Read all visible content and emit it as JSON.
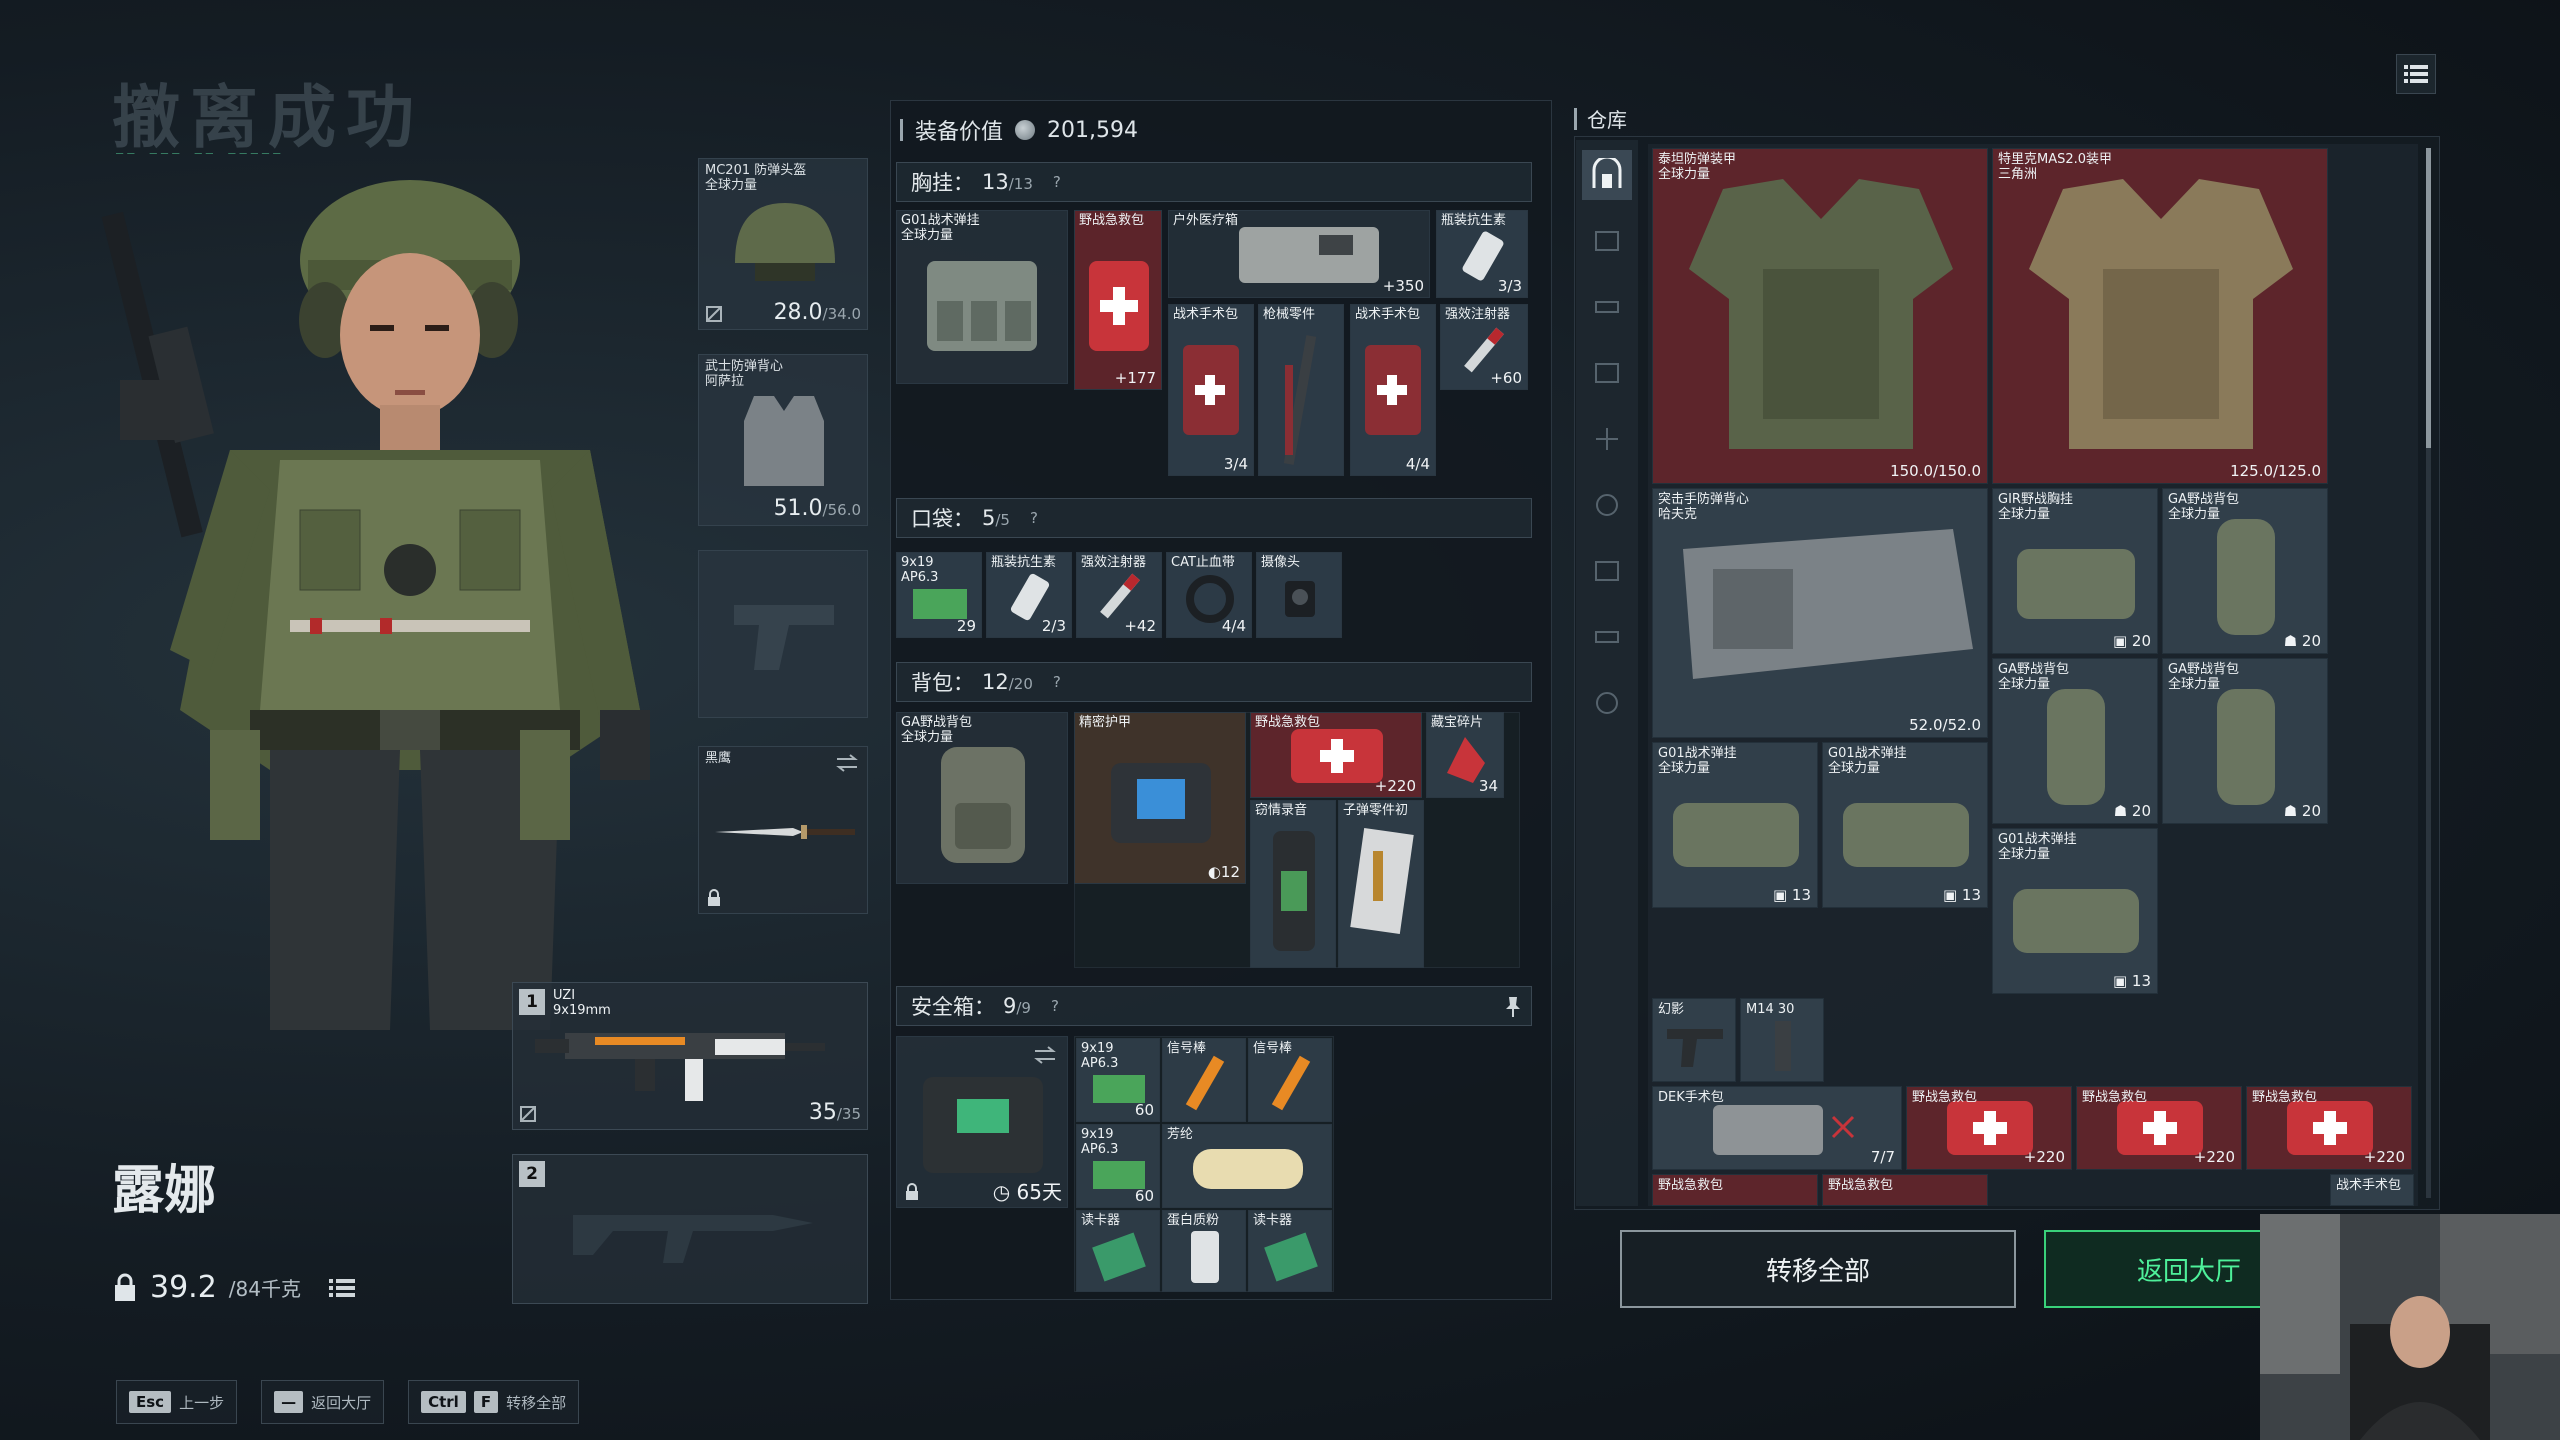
{
  "banner": {
    "title": "撤离成功"
  },
  "character": {
    "name": "露娜",
    "weight_value": "39.2",
    "weight_max": "/84千克"
  },
  "hotkeys": [
    {
      "key": "Esc",
      "label": "上一步"
    },
    {
      "key": "—",
      "label": "返回大厅"
    },
    {
      "key": "Ctrl",
      "key2": "F",
      "label": "转移全部"
    }
  ],
  "equipment": {
    "helmet": {
      "name": "MC201 防弹头盔",
      "sub": "全球力量",
      "durability": "28.0",
      "max": "/34.0"
    },
    "armor": {
      "name": "武士防弹背心",
      "sub": "阿萨拉",
      "durability": "51.0",
      "max": "/56.0"
    },
    "melee": {
      "name": "黑鹰"
    },
    "weapon1": {
      "slot": "1",
      "name": "UZI",
      "caliber": "9x19mm",
      "ammo": "35",
      "ammo_max": "/35"
    },
    "weapon2": {
      "slot": "2"
    }
  },
  "panel": {
    "value_label": "装备价值",
    "value": "201,594",
    "rig": {
      "label": "胸挂：",
      "used": "13",
      "cap": "/13"
    },
    "pocket": {
      "label": "口袋：",
      "used": "5",
      "cap": "/5"
    },
    "backpack": {
      "label": "背包：",
      "used": "12",
      "cap": "/20"
    },
    "safebox": {
      "label": "安全箱：",
      "used": "9",
      "cap": "/9",
      "days": "65天"
    },
    "rig_items": [
      {
        "name": "G01战术弹挂",
        "sub": "全球力量"
      },
      {
        "name": "野战急救包",
        "count": "177"
      },
      {
        "name": "户外医疗箱",
        "count": "350"
      },
      {
        "name": "瓶装抗生素",
        "count": "3/3"
      },
      {
        "name": "战术手术包",
        "count": "3/4"
      },
      {
        "name": "枪械零件"
      },
      {
        "name": "战术手术包",
        "count": "4/4"
      },
      {
        "name": "强效注射器",
        "count": "60"
      }
    ],
    "pocket_items": [
      {
        "name": "9x19",
        "sub": "AP6.3",
        "count": "29"
      },
      {
        "name": "瓶装抗生素",
        "count": "2/3"
      },
      {
        "name": "强效注射器",
        "count": "42"
      },
      {
        "name": "CAT止血带",
        "count": "4/4"
      },
      {
        "name": "摄像头"
      }
    ],
    "backpack_items": [
      {
        "name": "GA野战背包",
        "sub": "全球力量"
      },
      {
        "name": "精密护甲",
        "count": "12"
      },
      {
        "name": "野战急救包",
        "count": "220"
      },
      {
        "name": "藏宝碎片",
        "count": "34"
      },
      {
        "name": "窃情录音"
      },
      {
        "name": "子弹零件初"
      }
    ],
    "safebox_items": [
      {
        "name": "9x19",
        "sub": "AP6.3",
        "count": "60"
      },
      {
        "name": "信号棒"
      },
      {
        "name": "信号棒"
      },
      {
        "name": "9x19",
        "sub": "AP6.3",
        "count": "60"
      },
      {
        "name": "芳纶"
      },
      {
        "name": "读卡器"
      },
      {
        "name": "蛋白质粉"
      },
      {
        "name": "读卡器"
      }
    ]
  },
  "storage": {
    "label": "仓库",
    "items": [
      {
        "name": "泰坦防弹装甲",
        "sub": "全球力量",
        "count": "150.0/150.0"
      },
      {
        "name": "特里克MAS2.0装甲",
        "sub": "三角洲",
        "count": "125.0/125.0"
      },
      {
        "name": "突击手防弹背心",
        "sub": "哈夫克",
        "count": "52.0/52.0"
      },
      {
        "name": "GIR野战胸挂",
        "sub": "全球力量",
        "count": "20"
      },
      {
        "name": "GA野战背包",
        "sub": "全球力量",
        "count": "20"
      },
      {
        "name": "GA野战背包",
        "sub": "全球力量",
        "count": "20"
      },
      {
        "name": "GA野战背包",
        "sub": "全球力量",
        "count": "20"
      },
      {
        "name": "G01战术弹挂",
        "sub": "全球力量",
        "count": "13"
      },
      {
        "name": "G01战术弹挂",
        "sub": "全球力量",
        "count": "13"
      },
      {
        "name": "G01战术弹挂",
        "sub": "全球力量",
        "count": "13"
      },
      {
        "name": "幻影"
      },
      {
        "name": "M14 30"
      },
      {
        "name": "DEK手术包",
        "count": "7/7"
      },
      {
        "name": "野战急救包",
        "count": "220"
      },
      {
        "name": "野战急救包",
        "count": "220"
      },
      {
        "name": "野战急救包",
        "count": "220"
      },
      {
        "name": "野战急救包"
      },
      {
        "name": "野战急救包"
      },
      {
        "name": "战术手术包"
      }
    ]
  },
  "buttons": {
    "transfer_all": "转移全部",
    "return_lobby": "返回大厅"
  },
  "colors": {
    "accent_green": "#39d17a",
    "item_red": "#6e262c",
    "panel_dark": "#12191f"
  }
}
